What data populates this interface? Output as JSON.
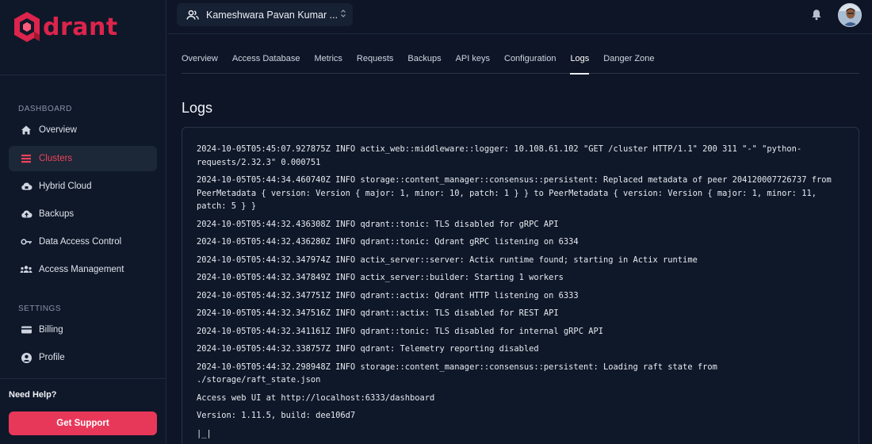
{
  "app": {
    "name": "drant"
  },
  "sidebar": {
    "sections": [
      {
        "label": "DASHBOARD"
      },
      {
        "label": "SETTINGS"
      }
    ],
    "items": [
      {
        "label": "Overview",
        "icon": "home-icon"
      },
      {
        "label": "Clusters",
        "icon": "list-icon",
        "active": true
      },
      {
        "label": "Hybrid Cloud",
        "icon": "cloud-icon"
      },
      {
        "label": "Backups",
        "icon": "cloud-upload-icon"
      },
      {
        "label": "Data Access Control",
        "icon": "key-icon"
      },
      {
        "label": "Access Management",
        "icon": "users-icon"
      },
      {
        "label": "Billing",
        "icon": "credit-card-icon"
      },
      {
        "label": "Profile",
        "icon": "user-circle-icon"
      }
    ],
    "help_text": "Need Help?",
    "support_button": "Get Support"
  },
  "header": {
    "account_name": "Kameshwara Pavan Kumar ..."
  },
  "tabs": [
    {
      "label": "Overview"
    },
    {
      "label": "Access Database"
    },
    {
      "label": "Metrics"
    },
    {
      "label": "Requests"
    },
    {
      "label": "Backups"
    },
    {
      "label": "API keys"
    },
    {
      "label": "Configuration"
    },
    {
      "label": "Logs",
      "active": true
    },
    {
      "label": "Danger Zone"
    }
  ],
  "page_title": "Logs",
  "logs": [
    "2024-10-05T05:45:07.927875Z INFO actix_web::middleware::logger: 10.108.61.102 \"GET /cluster HTTP/1.1\" 200 311 \"-\" \"python-requests/2.32.3\" 0.000751",
    "2024-10-05T05:44:34.460740Z INFO storage::content_manager::consensus::persistent: Replaced metadata of peer 204120007726737 from PeerMetadata { version: Version { major: 1, minor: 10, patch: 1 } } to PeerMetadata { version: Version { major: 1, minor: 11, patch: 5 } }",
    "2024-10-05T05:44:32.436308Z INFO qdrant::tonic: TLS disabled for gRPC API",
    "2024-10-05T05:44:32.436280Z INFO qdrant::tonic: Qdrant gRPC listening on 6334",
    "2024-10-05T05:44:32.347974Z INFO actix_server::server: Actix runtime found; starting in Actix runtime",
    "2024-10-05T05:44:32.347849Z INFO actix_server::builder: Starting 1 workers",
    "2024-10-05T05:44:32.347751Z INFO qdrant::actix: Qdrant HTTP listening on 6333",
    "2024-10-05T05:44:32.347516Z INFO qdrant::actix: TLS disabled for REST API",
    "2024-10-05T05:44:32.341161Z INFO qdrant::tonic: TLS disabled for internal gRPC API",
    "2024-10-05T05:44:32.338757Z INFO qdrant: Telemetry reporting disabled",
    "2024-10-05T05:44:32.298948Z INFO storage::content_manager::consensus::persistent: Loading raft state from ./storage/raft_state.json",
    "Access web UI at http://localhost:6333/dashboard",
    "Version: 1.11.5, build: dee106d7",
    "|_|"
  ],
  "colors": {
    "brand": "#dc244c",
    "accent": "#e8385a",
    "background": "#0d1526"
  }
}
